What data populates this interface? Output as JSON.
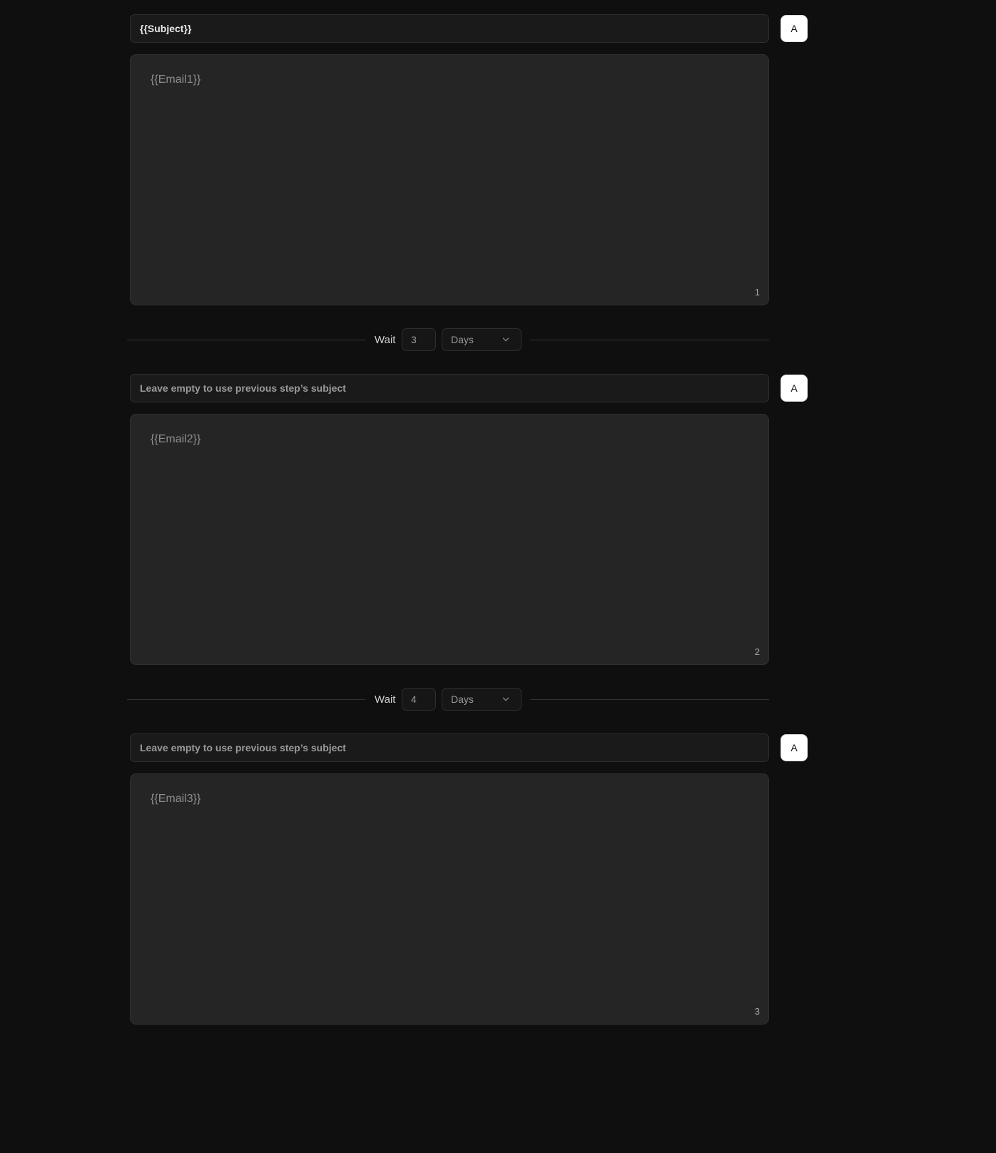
{
  "steps": [
    {
      "subject_value": "{{Subject}}",
      "ai_button_label": "A",
      "body_text": "{{Email1}}",
      "number": "1"
    },
    {
      "subject_placeholder": "Leave empty to use previous step’s subject",
      "ai_button_label": "A",
      "body_text": "{{Email2}}",
      "number": "2"
    },
    {
      "subject_placeholder": "Leave empty to use previous step’s subject",
      "ai_button_label": "A",
      "body_text": "{{Email3}}",
      "number": "3"
    }
  ],
  "waits": [
    {
      "label": "Wait",
      "value": "3",
      "unit": "Days"
    },
    {
      "label": "Wait",
      "value": "4",
      "unit": "Days"
    }
  ],
  "icons": {
    "unit_dropdown": "chevron-down-icon"
  }
}
